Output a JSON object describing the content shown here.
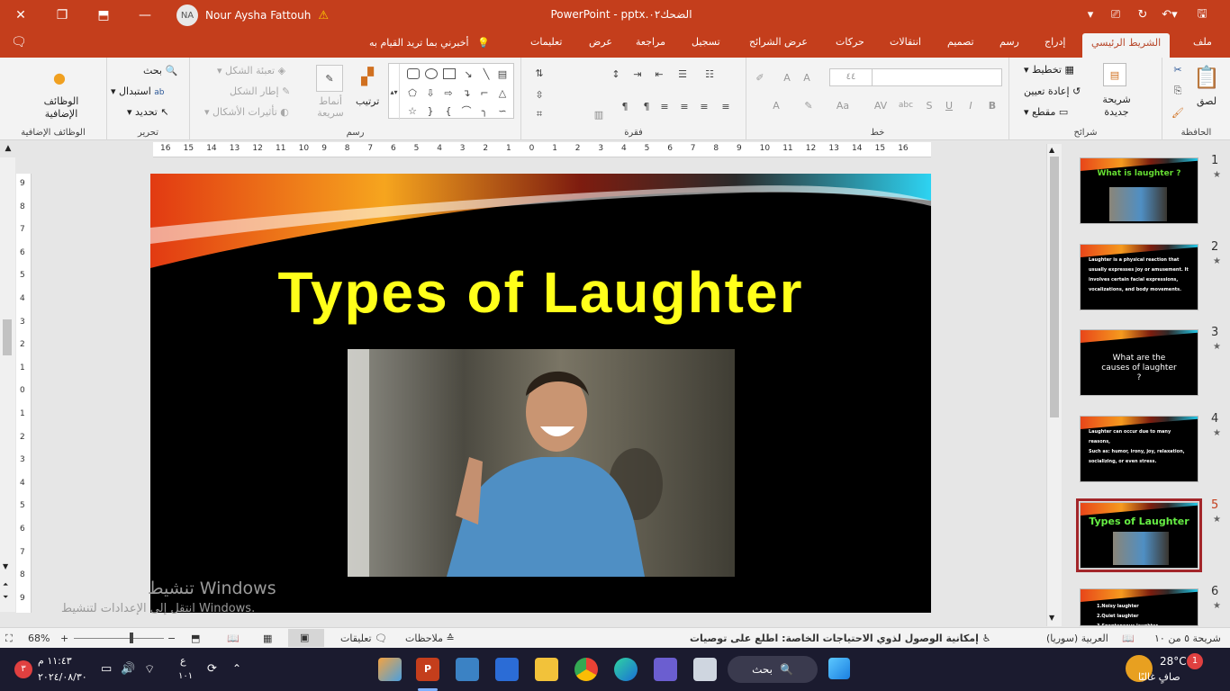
{
  "titlebar": {
    "app": "PowerPoint",
    "filename": "pptx.الضحك٠٢",
    "separator": "-",
    "user_name": "Nour Aysha Fattouh",
    "user_initials": "NA",
    "warning_icon": "warning-icon"
  },
  "tabs": {
    "items": [
      {
        "label": "ملف"
      },
      {
        "label": "الشريط الرئيسي",
        "active": true
      },
      {
        "label": "إدراج"
      },
      {
        "label": "رسم"
      },
      {
        "label": "تصميم"
      },
      {
        "label": "انتقالات"
      },
      {
        "label": "حركات"
      },
      {
        "label": "عرض الشرائح"
      },
      {
        "label": "تسجيل"
      },
      {
        "label": "مراجعة"
      },
      {
        "label": "عرض"
      },
      {
        "label": "تعليمات"
      }
    ],
    "tell_me": "أخبرني بما تريد القيام به"
  },
  "ribbon": {
    "clipboard": {
      "label": "الحافظة",
      "paste": "لصق"
    },
    "slides": {
      "label": "شرائح",
      "new_slide": "شريحة جديدة",
      "layout": "تخطيط",
      "reset": "إعادة تعيين",
      "section": "مقطع"
    },
    "font": {
      "label": "خط",
      "size": "٤٤"
    },
    "paragraph": {
      "label": "فقرة"
    },
    "drawing": {
      "label": "رسم",
      "arrange": "ترتيب",
      "quick_styles": "أنماط سريعة",
      "fill": "تعبئة الشكل",
      "outline": "إطار الشكل",
      "effects": "تأثيرات الأشكال"
    },
    "editing": {
      "label": "تحرير",
      "find": "بحث",
      "replace": "استبدال",
      "select": "تحديد"
    },
    "addins": {
      "label": "الوظائف الإضافية",
      "button": "الوظائف الإضافية"
    }
  },
  "rulers": {
    "horizontal": [
      "16",
      "15",
      "14",
      "13",
      "12",
      "11",
      "10",
      "9",
      "8",
      "7",
      "6",
      "5",
      "4",
      "3",
      "2",
      "1",
      "0",
      "1",
      "2",
      "3",
      "4",
      "5",
      "6",
      "7",
      "8",
      "9",
      "10",
      "11",
      "12",
      "13",
      "14",
      "15",
      "16"
    ],
    "vertical": [
      "9",
      "8",
      "7",
      "6",
      "5",
      "4",
      "3",
      "2",
      "1",
      "0",
      "1",
      "2",
      "3",
      "4",
      "5",
      "6",
      "7",
      "8",
      "9"
    ]
  },
  "slide": {
    "title": "Types of Laughter"
  },
  "thumbnails": [
    {
      "num": "1",
      "title": "What is laughter ?",
      "lines": []
    },
    {
      "num": "2",
      "title": "",
      "lines": [
        "Laughter is a physical reaction that",
        "usually expresses joy or amusement. It",
        "involves certain facial expressions,",
        "vocalizations, and body movements."
      ]
    },
    {
      "num": "3",
      "title": "What are the causes of laughter ?",
      "lines": []
    },
    {
      "num": "4",
      "title": "",
      "lines": [
        "Laughter can occur due to many",
        "reasons,",
        "Such as: humor, irony, joy, relaxation,",
        "socializing, or even stress."
      ]
    },
    {
      "num": "5",
      "title": "Types of Laughter",
      "lines": [],
      "selected": true
    },
    {
      "num": "6",
      "title": "",
      "lines": [
        "1.Noisy laughter",
        "2.Quiet laughter",
        "3.Spontaneous laughter"
      ]
    }
  ],
  "watermark": {
    "line1": "تنشيط Windows",
    "line2": "انتقل إلى الإعدادات لتنشيط Windows."
  },
  "statusbar": {
    "slide_info": "شريحة ٥ من ١٠",
    "language": "العربية (سوريا)",
    "accessibility": "إمكانية الوصول لذوي الاحتياجات الخاصة: اطلع على توصيات",
    "notes": "ملاحظات",
    "comments": "تعليقات",
    "zoom": "68%"
  },
  "taskbar": {
    "weather_temp": "28°C",
    "weather_desc": "صافٍ غالبًا",
    "weather_badge": "1",
    "search": "بحث",
    "time": "١١:٤٣ م",
    "date": "٢٠٢٤/٠٨/٣٠",
    "notification_count": "٣",
    "lang_top": "ع",
    "lang_bottom": "١٠١"
  },
  "colors": {
    "accent": "#c43e1c",
    "slide_title": "#ffff1a",
    "selected_thumb": "#a3262a"
  }
}
